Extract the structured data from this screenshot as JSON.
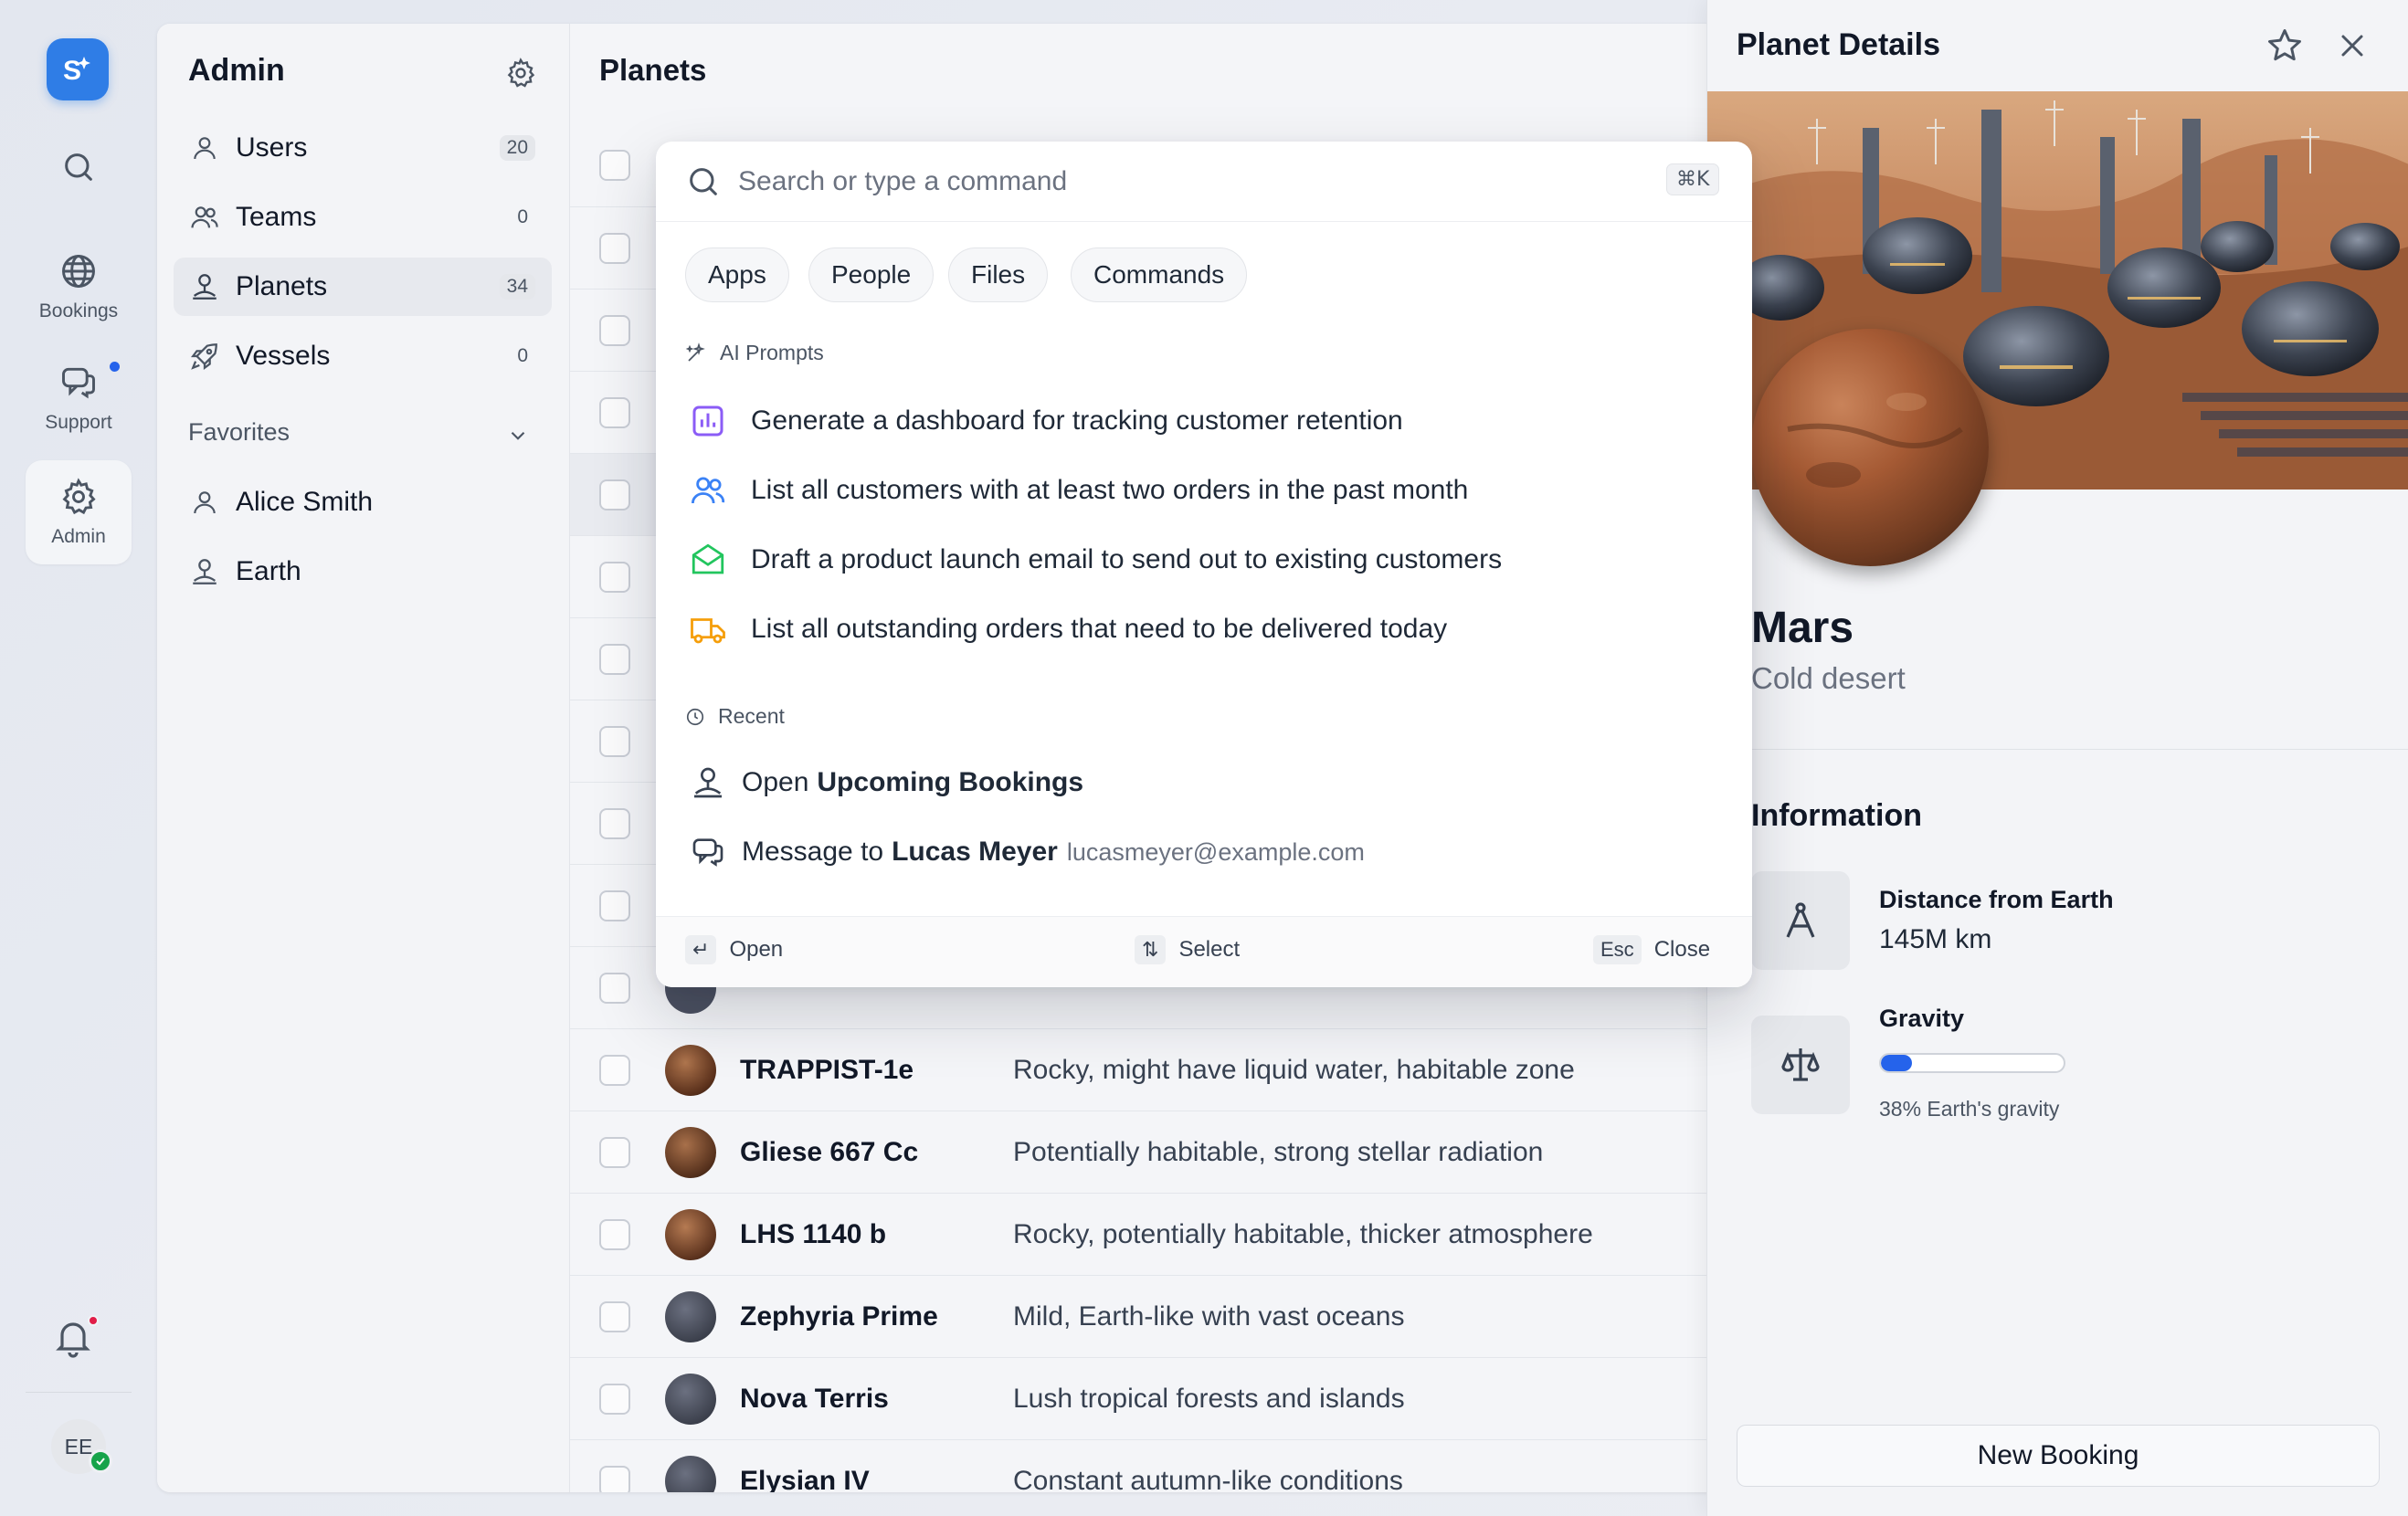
{
  "rail": {
    "items": [
      {
        "label": "",
        "icon": "search-icon"
      },
      {
        "label": "Bookings",
        "icon": "globe-icon"
      },
      {
        "label": "Support",
        "icon": "chat-icon"
      },
      {
        "label": "Admin",
        "icon": "gear-icon"
      }
    ],
    "avatar_initials": "EE"
  },
  "sidebar": {
    "title": "Admin",
    "items": [
      {
        "label": "Users",
        "count": "20",
        "icon": "user-icon"
      },
      {
        "label": "Teams",
        "count": "0",
        "icon": "users-icon"
      },
      {
        "label": "Planets",
        "count": "34",
        "icon": "planet-icon"
      },
      {
        "label": "Vessels",
        "count": "0",
        "icon": "rocket-icon"
      }
    ],
    "favorites_label": "Favorites",
    "favorites": [
      {
        "label": "Alice Smith",
        "icon": "user-icon"
      },
      {
        "label": "Earth",
        "icon": "planet-icon"
      }
    ]
  },
  "table": {
    "title": "Planets",
    "rows": [
      {
        "name": "TRAPPIST-1e",
        "description": "Rocky, might have liquid water, habitable zone",
        "avatar_color": "#7a4a2e"
      },
      {
        "name": "Gliese 667 Cc",
        "description": "Potentially habitable, strong stellar radiation",
        "avatar_color": "#6b3d25"
      },
      {
        "name": "LHS 1140 b",
        "description": "Rocky, potentially habitable, thicker atmosphere",
        "avatar_color": "#74452a"
      },
      {
        "name": "Zephyria Prime",
        "description": "Mild, Earth-like with vast oceans",
        "avatar_color": "#4b5060"
      },
      {
        "name": "Nova Terris",
        "description": "Lush tropical forests and islands",
        "avatar_color": "#4b5060"
      },
      {
        "name": "Elysian IV",
        "description": "Constant autumn-like conditions",
        "avatar_color": "#4b5060"
      }
    ]
  },
  "palette": {
    "search_placeholder": "Search or type a command",
    "shortcut": "⌘K",
    "chips": [
      "Apps",
      "People",
      "Files",
      "Commands"
    ],
    "ai_header": "AI Prompts",
    "prompts": [
      {
        "text": "Generate a dashboard for tracking customer retention",
        "icon": "chart-icon",
        "color": "#8b5cf6"
      },
      {
        "text": "List all customers with at least two orders in the past month",
        "icon": "users-icon",
        "color": "#3b82f6"
      },
      {
        "text": "Draft a product launch email to send out to existing customers",
        "icon": "envelope-icon",
        "color": "#22c55e"
      },
      {
        "text": "List all outstanding orders that need to be delivered today",
        "icon": "truck-icon",
        "color": "#f59e0b"
      }
    ],
    "recent_header": "Recent",
    "recent": [
      {
        "prefix": "Open",
        "bold": "Upcoming Bookings",
        "extra": "",
        "icon": "planet-icon"
      },
      {
        "prefix": "Message to",
        "bold": "Lucas Meyer",
        "extra": "lucasmeyer@example.com",
        "icon": "chat-icon"
      }
    ],
    "footer": {
      "open_label": "Open",
      "select_label": "Select",
      "esc_key": "Esc",
      "close_label": "Close"
    }
  },
  "detail": {
    "title": "Planet Details",
    "planet_name": "Mars",
    "planet_type": "Cold desert",
    "info_header": "Information",
    "distance_label": "Distance from Earth",
    "distance_value": "145M km",
    "gravity_label": "Gravity",
    "gravity_fraction": 0.38,
    "gravity_text": "38% Earth's gravity",
    "booking_button": "New Booking"
  },
  "colors": {
    "accent": "#2563eb",
    "logo": "#2f7de6",
    "notification": "#e11d48",
    "online": "#16a34a"
  }
}
